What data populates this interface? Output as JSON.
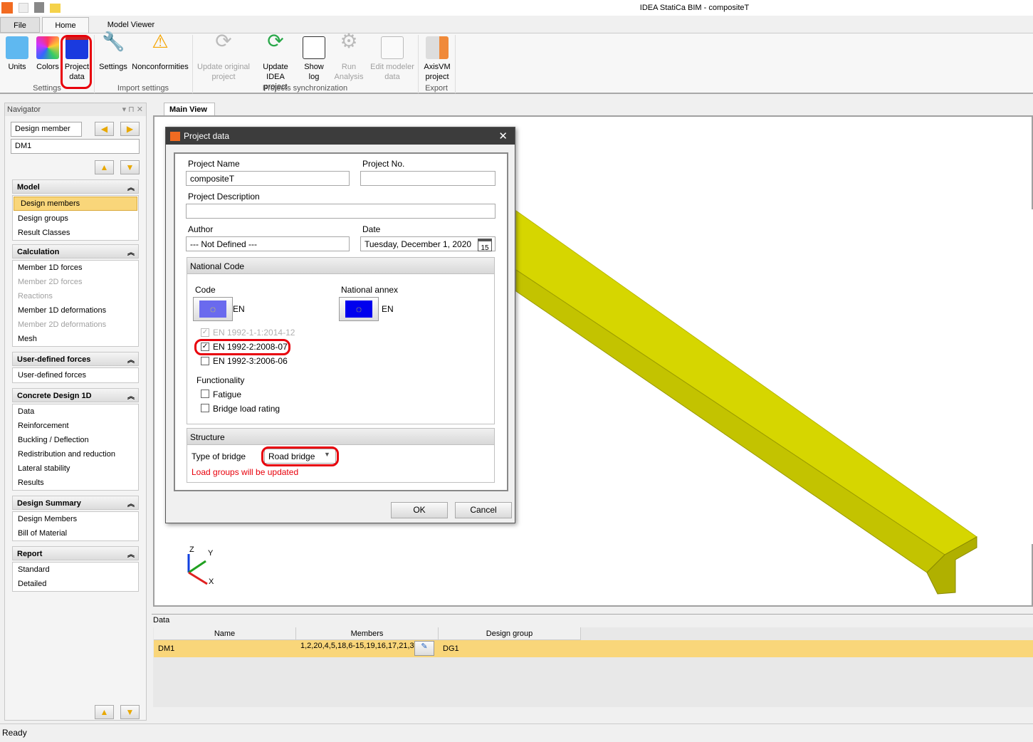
{
  "app": {
    "title": "IDEA StatiCa BIM - compositeT"
  },
  "tabs": [
    {
      "label": "File"
    },
    {
      "label": "Home"
    },
    {
      "label": "Model Viewer"
    }
  ],
  "ribbon": {
    "buttons": [
      {
        "label1": "Units",
        "label2": ""
      },
      {
        "label1": "Colors",
        "label2": ""
      },
      {
        "label1": "Project",
        "label2": "data"
      },
      {
        "label1": "Settings",
        "label2": ""
      },
      {
        "label1": "Nonconformities",
        "label2": ""
      },
      {
        "label1": "Update original",
        "label2": "project"
      },
      {
        "label1": "Update IDEA",
        "label2": "project"
      },
      {
        "label1": "Show",
        "label2": "log"
      },
      {
        "label1": "Run",
        "label2": "Analysis"
      },
      {
        "label1": "Edit modeler",
        "label2": "data"
      },
      {
        "label1": "AxisVM",
        "label2": "project"
      }
    ],
    "groups": [
      "Settings",
      "Import settings",
      "Projects synchronization",
      "Export"
    ]
  },
  "navigator": {
    "title": "Navigator",
    "type_select": "Design member",
    "member_select": "DM1",
    "sections": [
      {
        "title": "Model",
        "items": [
          "Design members",
          "Design groups",
          "Result Classes"
        ]
      },
      {
        "title": "Calculation",
        "items": [
          "Member 1D forces",
          "Member 2D forces",
          "Reactions",
          "Member 1D deformations",
          "Member 2D deformations",
          "Mesh"
        ]
      },
      {
        "title": "User-defined forces",
        "items": [
          "User-defined forces"
        ]
      },
      {
        "title": "Concrete Design 1D",
        "items": [
          "Data",
          "Reinforcement",
          "Buckling / Deflection",
          "Redistribution and reduction",
          "Lateral stability",
          "Results"
        ]
      },
      {
        "title": "Design Summary",
        "items": [
          "Design Members",
          "Bill of Material"
        ]
      },
      {
        "title": "Report",
        "items": [
          "Standard",
          "Detailed"
        ]
      }
    ]
  },
  "main_view": {
    "tab": "Main View",
    "axes": {
      "z": "Z",
      "y": "Y",
      "x": "X"
    }
  },
  "dialog": {
    "title": "Project data",
    "project_name_label": "Project Name",
    "project_name": "compositeT",
    "project_no_label": "Project No.",
    "project_no": "",
    "description_label": "Project Description",
    "description": "",
    "author_label": "Author",
    "author": "--- Not Defined ---",
    "date_label": "Date",
    "date": "Tuesday, December 1, 2020",
    "calendar_day": "15",
    "national_code_header": "National Code",
    "code_label": "Code",
    "code_value": "EN",
    "annex_label": "National annex",
    "annex_value": "EN",
    "standards": [
      {
        "label": "EN 1992-1-1:2014-12",
        "checked": true,
        "disabled": true
      },
      {
        "label": "EN 1992-2:2008-07",
        "checked": true,
        "disabled": false
      },
      {
        "label": "EN 1992-3:2006-06",
        "checked": false,
        "disabled": false
      }
    ],
    "functionality_label": "Functionality",
    "functionality": [
      {
        "label": "Fatigue",
        "checked": false
      },
      {
        "label": "Bridge load rating",
        "checked": false
      }
    ],
    "structure_header": "Structure",
    "bridge_type_label": "Type of bridge",
    "bridge_type": "Road bridge",
    "warning": "Load groups will be updated",
    "ok": "OK",
    "cancel": "Cancel"
  },
  "data_panel": {
    "title": "Data",
    "columns": [
      "Name",
      "Members",
      "Design group"
    ],
    "rows": [
      {
        "name": "DM1",
        "members": "1,2,20,4,5,18,6-15,19,16,17,21,3",
        "group": "DG1"
      }
    ]
  },
  "status": "Ready",
  "colors": {
    "highlight": "#e8000b",
    "selection": "#f9d67a",
    "beam": "#d8d800"
  }
}
